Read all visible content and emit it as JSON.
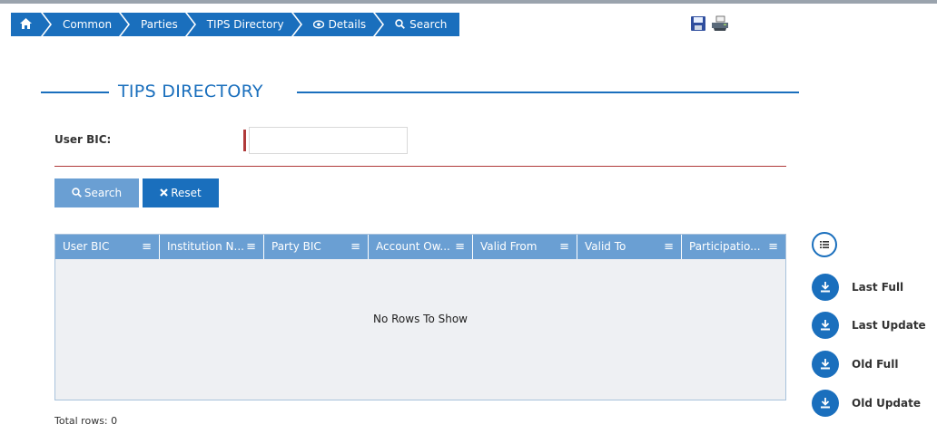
{
  "breadcrumb": {
    "items": [
      "Common",
      "Parties",
      "TIPS Directory",
      "Details",
      "Search"
    ],
    "icons": [
      "home-icon",
      "eye-icon",
      "search-icon"
    ]
  },
  "page": {
    "title": "TIPS DIRECTORY"
  },
  "form": {
    "user_bic_label": "User BIC:",
    "user_bic_value": ""
  },
  "buttons": {
    "search": "Search",
    "reset": "Reset"
  },
  "grid": {
    "columns": [
      "User BIC",
      "Institution N...",
      "Party BIC",
      "Account Ow...",
      "Valid From",
      "Valid To",
      "Participatio..."
    ],
    "empty_message": "No Rows To Show",
    "total_label": "Total rows: 0"
  },
  "downloads": [
    "Last Full",
    "Last Update",
    "Old Full",
    "Old Update"
  ],
  "colors": {
    "primary": "#1a6fbd",
    "light_primary": "#6a9fd3",
    "required": "#b03a3a",
    "grid_bg": "#eef0f3"
  }
}
